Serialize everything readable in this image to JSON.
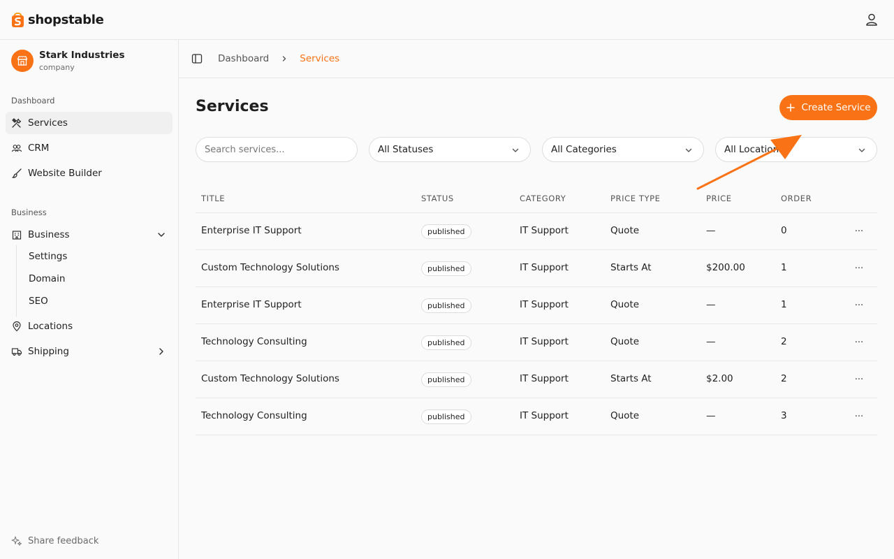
{
  "brand": {
    "name": "shopstable",
    "accent": "#f97316"
  },
  "org": {
    "name": "Stark Industries",
    "type": "company"
  },
  "sidebar": {
    "section_dashboard": "Dashboard",
    "section_business": "Business",
    "items": [
      {
        "label": "Services",
        "icon": "tools-icon",
        "active": true
      },
      {
        "label": "CRM",
        "icon": "users-icon"
      },
      {
        "label": "Website Builder",
        "icon": "brush-icon"
      },
      {
        "label": "Business",
        "icon": "building-icon",
        "expanded": true
      },
      {
        "label": "Locations",
        "icon": "map-pin-icon"
      },
      {
        "label": "Shipping",
        "icon": "truck-icon"
      }
    ],
    "sub_items": [
      "Settings",
      "Domain",
      "SEO"
    ],
    "feedback": "Share feedback"
  },
  "breadcrumb": {
    "home": "Dashboard",
    "current": "Services"
  },
  "page": {
    "title": "Services",
    "create_label": "Create Service"
  },
  "filters": {
    "search_placeholder": "Search services...",
    "status": "All Statuses",
    "category": "All Categories",
    "location": "All Locations"
  },
  "table": {
    "headers": [
      "TITLE",
      "STATUS",
      "CATEGORY",
      "PRICE TYPE",
      "PRICE",
      "ORDER"
    ],
    "rows": [
      {
        "title": "Enterprise IT Support",
        "status": "published",
        "category": "IT Support",
        "price_type": "Quote",
        "price": "—",
        "order": "0"
      },
      {
        "title": "Custom Technology Solutions",
        "status": "published",
        "category": "IT Support",
        "price_type": "Starts At",
        "price": "$200.00",
        "order": "1"
      },
      {
        "title": "Enterprise IT Support",
        "status": "published",
        "category": "IT Support",
        "price_type": "Quote",
        "price": "—",
        "order": "1"
      },
      {
        "title": "Technology Consulting",
        "status": "published",
        "category": "IT Support",
        "price_type": "Quote",
        "price": "—",
        "order": "2"
      },
      {
        "title": "Custom Technology Solutions",
        "status": "published",
        "category": "IT Support",
        "price_type": "Starts At",
        "price": "$2.00",
        "order": "2"
      },
      {
        "title": "Technology Consulting",
        "status": "published",
        "category": "IT Support",
        "price_type": "Quote",
        "price": "—",
        "order": "3"
      }
    ],
    "more_label": "···"
  }
}
